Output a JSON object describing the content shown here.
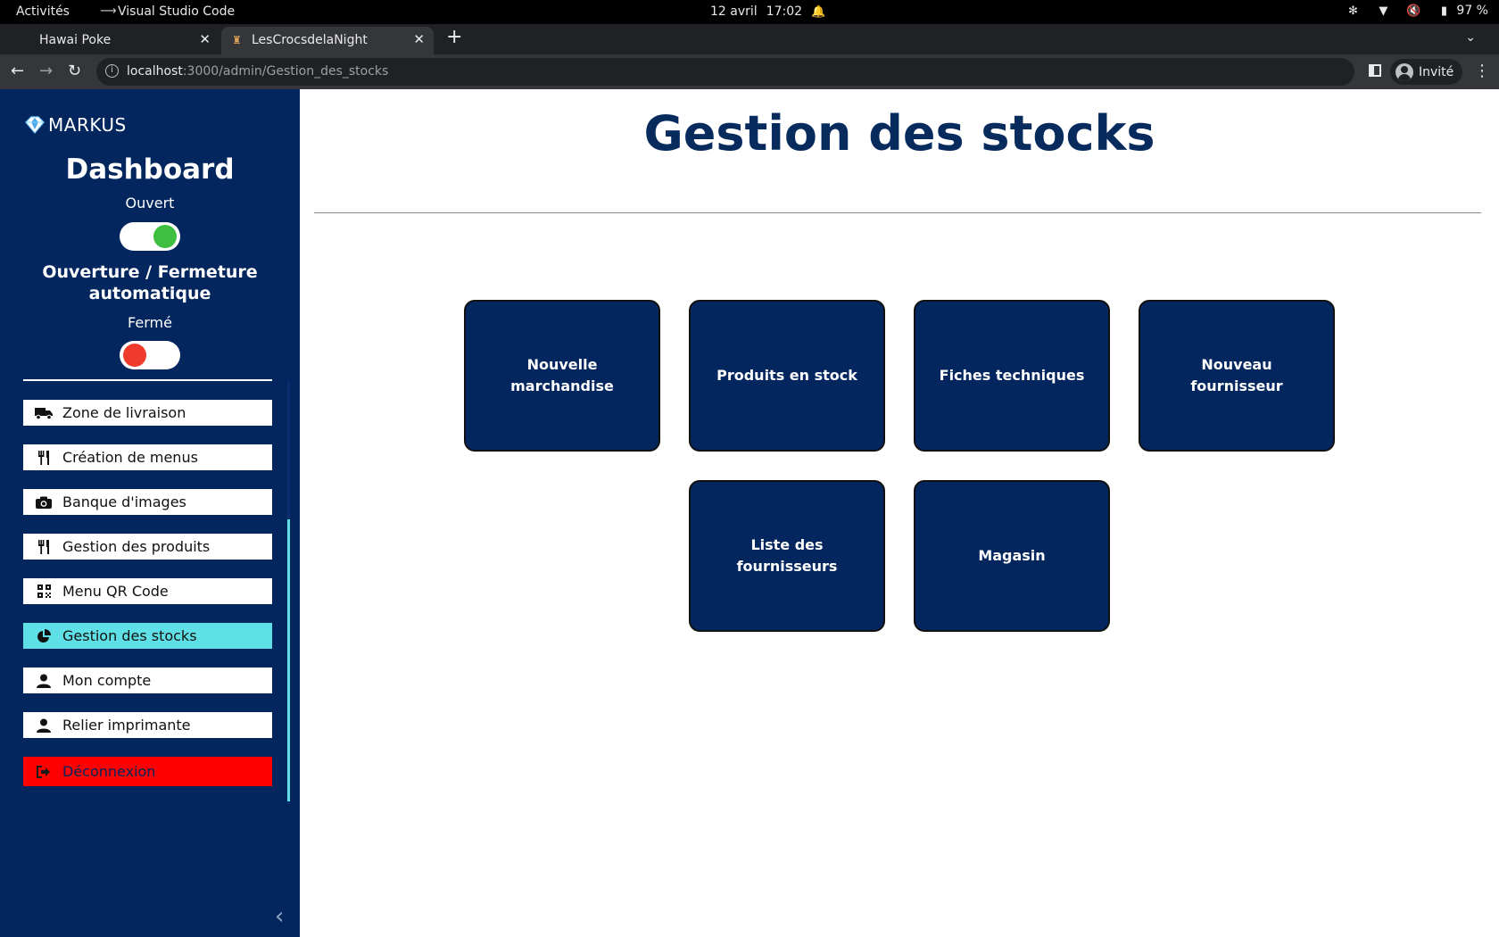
{
  "os_bar": {
    "activities": "Activités",
    "app_name": "Visual Studio Code",
    "date": "12 avril",
    "time": "17:02",
    "battery": "97 %"
  },
  "browser": {
    "tabs": [
      {
        "title": "Hawai Poke",
        "active": false
      },
      {
        "title": "LesCrocsdelaNight",
        "active": true
      }
    ],
    "url_host": "localhost",
    "url_path": ":3000/admin/Gestion_des_stocks",
    "profile": "Invité"
  },
  "sidebar": {
    "logo_text": "MARKUS",
    "title": "Dashboard",
    "open_label": "Ouvert",
    "open_toggle_on": true,
    "auto_label": "Ouverture / Fermeture automatique",
    "closed_label": "Fermé",
    "closed_toggle_on": false,
    "items": [
      {
        "label": "Zone de livraison",
        "icon": "truck-icon",
        "active": false
      },
      {
        "label": "Création de menus",
        "icon": "utensils-icon",
        "active": false
      },
      {
        "label": "Banque d'images",
        "icon": "camera-icon",
        "active": false
      },
      {
        "label": "Gestion des produits",
        "icon": "utensils-icon",
        "active": false
      },
      {
        "label": "Menu QR Code",
        "icon": "qrcode-icon",
        "active": false
      },
      {
        "label": "Gestion des stocks",
        "icon": "pie-chart-icon",
        "active": true
      },
      {
        "label": "Mon compte",
        "icon": "user-icon",
        "active": false
      },
      {
        "label": "Relier imprimante",
        "icon": "user-icon",
        "active": false
      }
    ],
    "logout_label": "Déconnexion",
    "colors": {
      "background": "#03265e",
      "active_item": "#5fe0e6",
      "logout": "#ff0000",
      "toggle_on": "#3fbf3f",
      "toggle_off": "#ee3b2b"
    }
  },
  "main": {
    "title": "Gestion des stocks",
    "cards": [
      {
        "label": "Nouvelle marchandise"
      },
      {
        "label": "Produits en stock"
      },
      {
        "label": "Fiches techniques"
      },
      {
        "label": "Nouveau fournisseur"
      },
      {
        "label": "Liste des fournisseurs"
      },
      {
        "label": "Magasin"
      }
    ],
    "colors": {
      "card": "#03265e",
      "title": "#082b5e"
    }
  }
}
